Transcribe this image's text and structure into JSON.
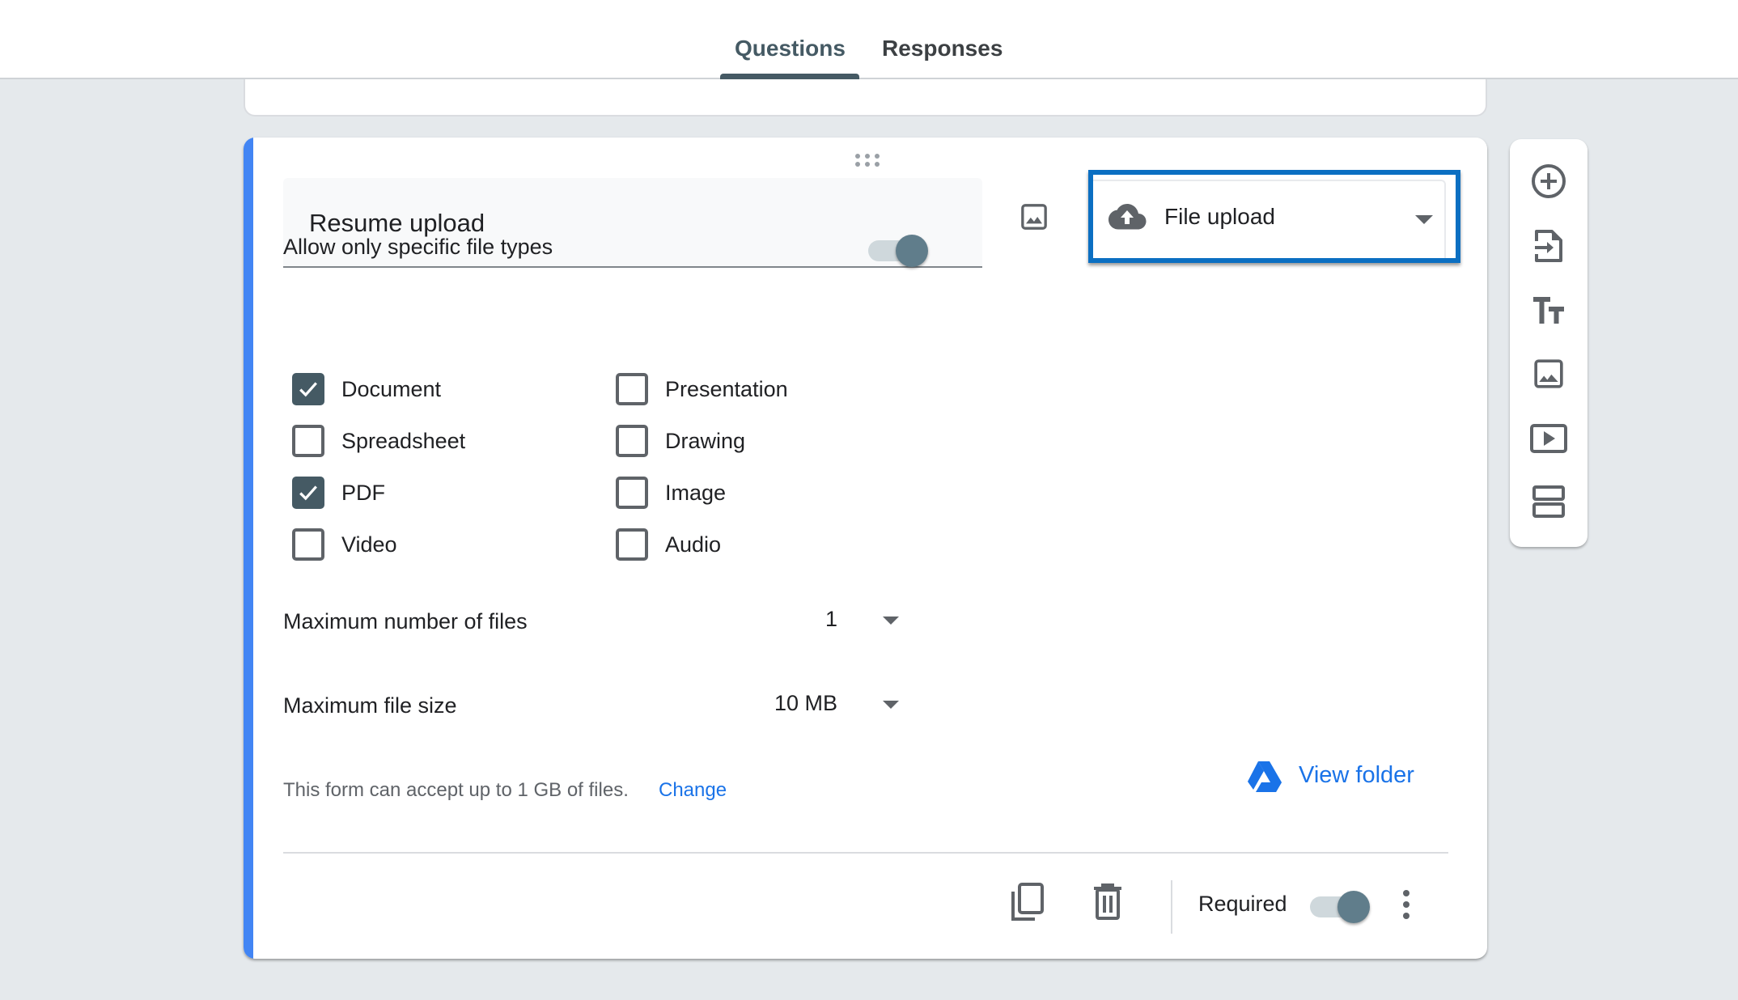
{
  "header": {
    "tabs": [
      {
        "label": "Questions",
        "active": true
      },
      {
        "label": "Responses",
        "active": false
      }
    ]
  },
  "question": {
    "title": "Resume upload",
    "type": {
      "label": "File upload",
      "icon": "cloud-upload-icon"
    },
    "allow_specific_types": {
      "label": "Allow only specific file types",
      "enabled": true
    },
    "file_types": [
      {
        "label": "Document",
        "checked": true
      },
      {
        "label": "Presentation",
        "checked": false
      },
      {
        "label": "Spreadsheet",
        "checked": false
      },
      {
        "label": "Drawing",
        "checked": false
      },
      {
        "label": "PDF",
        "checked": true
      },
      {
        "label": "Image",
        "checked": false
      },
      {
        "label": "Video",
        "checked": false
      },
      {
        "label": "Audio",
        "checked": false
      }
    ],
    "max_files": {
      "label": "Maximum number of files",
      "value": "1"
    },
    "max_size": {
      "label": "Maximum file size",
      "value": "10 MB"
    },
    "note": {
      "text": "This form can accept up to 1 GB of files.",
      "link": "Change"
    },
    "view_folder": {
      "label": "View folder",
      "icon": "google-drive-icon"
    },
    "footer": {
      "required_label": "Required",
      "required": true,
      "icons": [
        "duplicate-icon",
        "delete-icon",
        "more-vert-icon"
      ]
    }
  },
  "side_toolbar": {
    "items": [
      "add-question-icon",
      "import-questions-icon",
      "add-title-icon",
      "add-image-icon",
      "add-video-icon",
      "add-section-icon"
    ]
  },
  "colors": {
    "accent": "#4285f4",
    "theme": "#455a64",
    "link": "#1a73e8",
    "highlight_outline": "#0b6fc2"
  }
}
